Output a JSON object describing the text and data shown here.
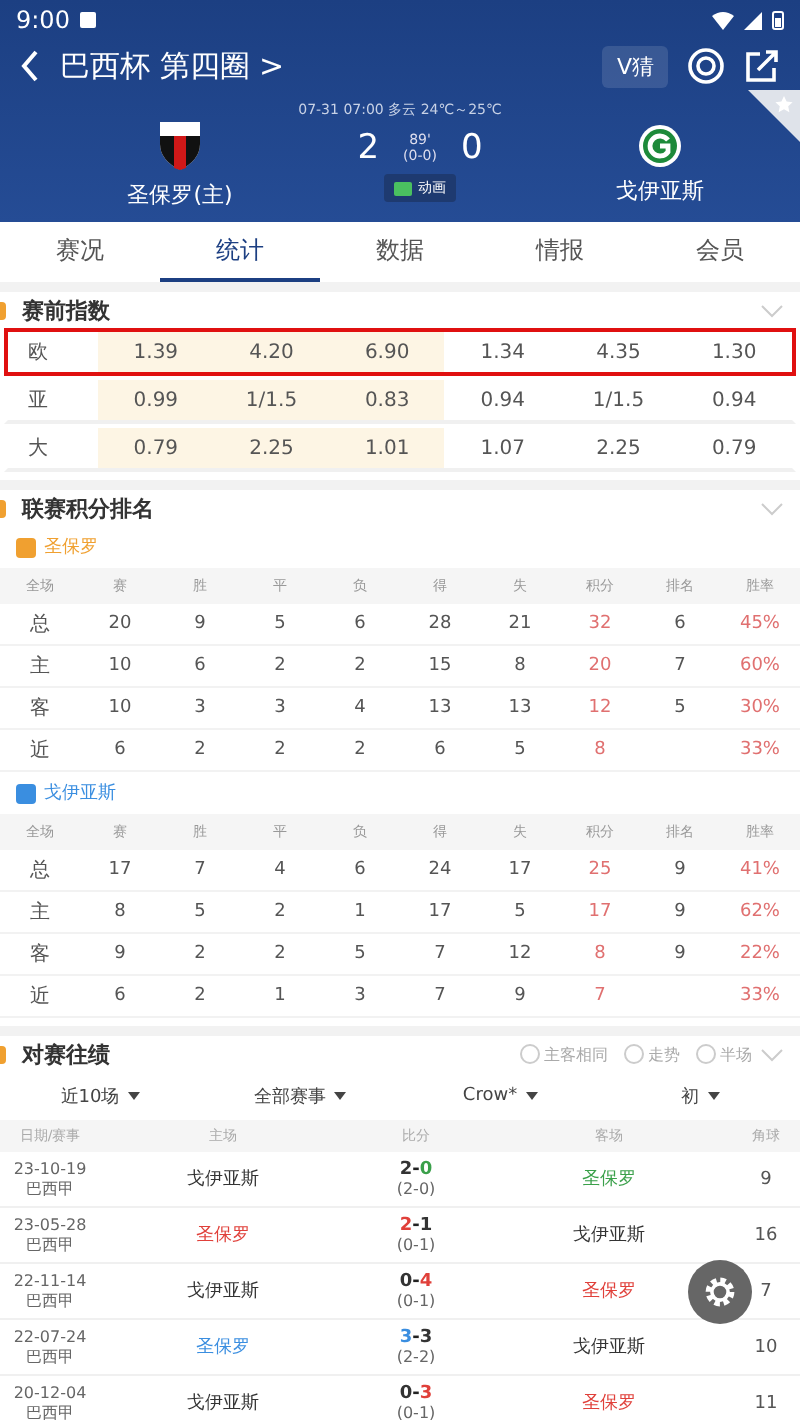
{
  "status_bar": {
    "time": "9:00"
  },
  "header": {
    "title": "巴西杯 第四圈 >",
    "vip_button": "V猜",
    "match_info": "07-31 07:00  多云 24℃～25℃",
    "home_team": "圣保罗(主)",
    "away_team": "戈伊亚斯",
    "home_score": "2",
    "away_score": "0",
    "minute": "89'",
    "half_score": "(0-0)",
    "animation_label": "动画"
  },
  "tabs": [
    {
      "label": "赛况",
      "selected": false
    },
    {
      "label": "统计",
      "selected": true
    },
    {
      "label": "数据",
      "selected": false
    },
    {
      "label": "情报",
      "selected": false
    },
    {
      "label": "会员",
      "selected": false
    }
  ],
  "odds": {
    "title": "赛前指数",
    "rows": [
      {
        "label": "欧",
        "values": [
          "1.39",
          "4.20",
          "6.90",
          "1.34",
          "4.35",
          "1.30"
        ],
        "highlighted": true
      },
      {
        "label": "亚",
        "values": [
          "0.99",
          "1/1.5",
          "0.83",
          "0.94",
          "1/1.5",
          "0.94"
        ],
        "highlighted": false
      },
      {
        "label": "大",
        "values": [
          "0.79",
          "2.25",
          "1.01",
          "1.07",
          "2.25",
          "0.79"
        ],
        "highlighted": false
      }
    ]
  },
  "standings": {
    "title": "联赛积分排名",
    "teams": [
      {
        "name": "圣保罗",
        "color": "#f0a030",
        "columns": [
          "全场",
          "赛",
          "胜",
          "平",
          "负",
          "得",
          "失",
          "积分",
          "排名",
          "胜率"
        ],
        "rows": [
          [
            "总",
            "20",
            "9",
            "5",
            "6",
            "28",
            "21",
            "32",
            "6",
            "45%"
          ],
          [
            "主",
            "10",
            "6",
            "2",
            "2",
            "15",
            "8",
            "20",
            "7",
            "60%"
          ],
          [
            "客",
            "10",
            "3",
            "3",
            "4",
            "13",
            "13",
            "12",
            "5",
            "30%"
          ],
          [
            "近",
            "6",
            "2",
            "2",
            "2",
            "6",
            "5",
            "8",
            "",
            "33%"
          ]
        ]
      },
      {
        "name": "戈伊亚斯",
        "color": "#3a8ee0",
        "columns": [
          "全场",
          "赛",
          "胜",
          "平",
          "负",
          "得",
          "失",
          "积分",
          "排名",
          "胜率"
        ],
        "rows": [
          [
            "总",
            "17",
            "7",
            "4",
            "6",
            "24",
            "17",
            "25",
            "9",
            "41%"
          ],
          [
            "主",
            "8",
            "5",
            "2",
            "1",
            "17",
            "5",
            "17",
            "9",
            "62%"
          ],
          [
            "客",
            "9",
            "2",
            "2",
            "5",
            "7",
            "12",
            "8",
            "9",
            "22%"
          ],
          [
            "近",
            "6",
            "2",
            "1",
            "3",
            "7",
            "9",
            "7",
            "",
            "33%"
          ]
        ]
      }
    ]
  },
  "h2h": {
    "title": "对赛往绩",
    "options": [
      {
        "label": "主客相同",
        "checked": false
      },
      {
        "label": "走势",
        "checked": false
      },
      {
        "label": "半场",
        "checked": false
      }
    ],
    "filters": [
      "近10场",
      "全部赛事",
      "Crow*",
      "初"
    ],
    "columns": [
      "日期/赛事",
      "主场",
      "比分",
      "客场",
      "角球"
    ],
    "rows": [
      {
        "date": "23-10-19",
        "league": "巴西甲",
        "home": "戈伊亚斯",
        "away": "圣保罗",
        "home_goals": "2",
        "separator": "-",
        "away_goals": "0",
        "half": "(2-0)",
        "corners": "9",
        "home_highlighted": false,
        "color": "#3aa04a"
      },
      {
        "date": "23-05-28",
        "league": "巴西甲",
        "home": "圣保罗",
        "away": "戈伊亚斯",
        "home_goals": "2",
        "separator": "-",
        "away_goals": "1",
        "half": "(0-1)",
        "corners": "16",
        "home_highlighted": true,
        "color": "#e0403a"
      },
      {
        "date": "22-11-14",
        "league": "巴西甲",
        "home": "戈伊亚斯",
        "away": "圣保罗",
        "home_goals": "0",
        "separator": "-",
        "away_goals": "4",
        "half": "(0-1)",
        "corners": "7",
        "home_highlighted": false,
        "color": "#e0403a"
      },
      {
        "date": "22-07-24",
        "league": "巴西甲",
        "home": "圣保罗",
        "away": "戈伊亚斯",
        "home_goals": "3",
        "separator": "-",
        "away_goals": "3",
        "half": "(2-2)",
        "corners": "10",
        "home_highlighted": true,
        "color": "#3a8ee0"
      },
      {
        "date": "20-12-04",
        "league": "巴西甲",
        "home": "戈伊亚斯",
        "away": "圣保罗",
        "home_goals": "0",
        "separator": "-",
        "away_goals": "3",
        "half": "(0-1)",
        "corners": "11",
        "home_highlighted": false,
        "color": "#e0403a"
      }
    ]
  }
}
